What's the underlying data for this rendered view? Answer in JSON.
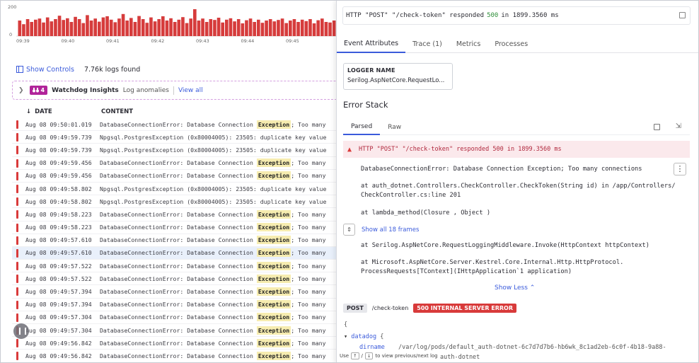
{
  "histogram": {
    "y_ticks": [
      "200",
      "0"
    ],
    "x_ticks": [
      "09:39",
      "09:40",
      "09:41",
      "09:42",
      "09:43",
      "09:44",
      "09:45"
    ],
    "bar_color": "#d63c3c",
    "bar_levels": [
      0.55,
      0.42,
      0.6,
      0.5,
      0.58,
      0.62,
      0.48,
      0.66,
      0.52,
      0.6,
      0.72,
      0.57,
      0.63,
      0.5,
      0.68,
      0.6,
      0.46,
      0.74,
      0.55,
      0.62,
      0.51,
      0.66,
      0.7,
      0.58,
      0.49,
      0.62,
      0.78,
      0.55,
      0.64,
      0.5,
      0.71,
      0.6,
      0.47,
      0.66,
      0.52,
      0.6,
      0.7,
      0.55,
      0.63,
      0.5,
      0.58,
      0.67,
      0.46,
      0.62,
      0.95,
      0.55,
      0.62,
      0.5,
      0.6,
      0.57,
      0.65,
      0.48,
      0.58,
      0.63,
      0.52,
      0.6,
      0.45,
      0.56,
      0.62,
      0.5,
      0.58,
      0.47,
      0.55,
      0.6,
      0.52,
      0.57,
      0.62,
      0.46,
      0.55,
      0.6,
      0.5,
      0.58,
      0.53,
      0.6,
      0.45,
      0.56,
      0.62,
      0.5,
      0.48,
      0.55
    ]
  },
  "toolbar": {
    "show_controls": "Show Controls",
    "logs_found": "7.76k logs found"
  },
  "watchdog": {
    "count": "4",
    "title": "Watchdog Insights",
    "subtitle": "Log anomalies",
    "view_all": "View all"
  },
  "columns": {
    "date": "DATE",
    "content": "CONTENT"
  },
  "rows": [
    {
      "date": "Aug 08 09:50:01.019",
      "pre": "DatabaseConnectionError: Database Connection ",
      "hl": "Exception",
      "post": "; Too many"
    },
    {
      "date": "Aug 08 09:49:59.739",
      "pre": "Npgsql.PostgresException (0x80004005): 23505: duplicate key value",
      "hl": "",
      "post": ""
    },
    {
      "date": "Aug 08 09:49:59.739",
      "pre": "Npgsql.PostgresException (0x80004005): 23505: duplicate key value",
      "hl": "",
      "post": ""
    },
    {
      "date": "Aug 08 09:49:59.456",
      "pre": "DatabaseConnectionError: Database Connection ",
      "hl": "Exception",
      "post": "; Too many"
    },
    {
      "date": "Aug 08 09:49:59.456",
      "pre": "DatabaseConnectionError: Database Connection ",
      "hl": "Exception",
      "post": "; Too many"
    },
    {
      "date": "Aug 08 09:49:58.802",
      "pre": "Npgsql.PostgresException (0x80004005): 23505: duplicate key value",
      "hl": "",
      "post": ""
    },
    {
      "date": "Aug 08 09:49:58.802",
      "pre": "Npgsql.PostgresException (0x80004005): 23505: duplicate key value",
      "hl": "",
      "post": ""
    },
    {
      "date": "Aug 08 09:49:58.223",
      "pre": "DatabaseConnectionError: Database Connection ",
      "hl": "Exception",
      "post": "; Too many"
    },
    {
      "date": "Aug 08 09:49:58.223",
      "pre": "DatabaseConnectionError: Database Connection ",
      "hl": "Exception",
      "post": "; Too many"
    },
    {
      "date": "Aug 08 09:49:57.610",
      "pre": "DatabaseConnectionError: Database Connection ",
      "hl": "Exception",
      "post": "; Too many"
    },
    {
      "date": "Aug 08 09:49:57.610",
      "pre": "DatabaseConnectionError: Database Connection ",
      "hl": "Exception",
      "post": "; Too many",
      "selected": true
    },
    {
      "date": "Aug 08 09:49:57.522",
      "pre": "DatabaseConnectionError: Database Connection ",
      "hl": "Exception",
      "post": "; Too many"
    },
    {
      "date": "Aug 08 09:49:57.522",
      "pre": "DatabaseConnectionError: Database Connection ",
      "hl": "Exception",
      "post": "; Too many"
    },
    {
      "date": "Aug 08 09:49:57.394",
      "pre": "DatabaseConnectionError: Database Connection ",
      "hl": "Exception",
      "post": "; Too many"
    },
    {
      "date": "Aug 08 09:49:57.394",
      "pre": "DatabaseConnectionError: Database Connection ",
      "hl": "Exception",
      "post": "; Too many"
    },
    {
      "date": "Aug 08 09:49:57.304",
      "pre": "DatabaseConnectionError: Database Connection ",
      "hl": "Exception",
      "post": "; Too many"
    },
    {
      "date": "Aug 08 09:49:57.304",
      "pre": "DatabaseConnectionError: Database Connection ",
      "hl": "Exception",
      "post": "; Too many"
    },
    {
      "date": "Aug 08 09:49:56.842",
      "pre": "DatabaseConnectionError: Database Connection ",
      "hl": "Exception",
      "post": "; Too many"
    },
    {
      "date": "Aug 08 09:49:56.842",
      "pre": "DatabaseConnectionError: Database Connection ",
      "hl": "Exception",
      "post": "; Too many"
    }
  ],
  "detail": {
    "title_pre": "HTTP \"POST\" \"/check-token\" responded ",
    "title_code": "500",
    "title_post": " in 1899.3560 ms",
    "tabs": [
      "Event Attributes",
      "Trace (1)",
      "Metrics",
      "Processes"
    ],
    "logger_key": "LOGGER NAME",
    "logger_value": "Serilog.AspNetCore.RequestLo...",
    "error_stack_title": "Error Stack",
    "stack_tabs": [
      "Parsed",
      "Raw"
    ],
    "error_message": "HTTP \"POST\" \"/check-token\" responded 500 in 1899.3560 ms",
    "stack_lines": [
      "DatabaseConnectionError: Database Connection Exception; Too many connections",
      "at auth_dotnet.Controllers.CheckController.CheckToken(String id) in /app/Controllers/",
      "CheckController.cs:line 201",
      "at lambda_method(Closure , Object )",
      "at Serilog.AspNetCore.RequestLoggingMiddleware.Invoke(HttpContext httpContext)",
      "at Microsoft.AspNetCore.Server.Kestrel.Core.Internal.Http.HttpProtocol.",
      "ProcessRequests[TContext](IHttpApplication`1 application)"
    ],
    "show_all": "Show all 18 frames",
    "show_less": "Show Less",
    "method": "POST",
    "path": "/check-token",
    "status": "500 INTERNAL SERVER ERROR",
    "json_open": "{",
    "json_key": "datadog",
    "json_brace": "{",
    "json_dirname_key": "dirname",
    "json_dirname_val": "/var/log/pods/default_auth-dotnet-6c7d7d7b6-hb6wk_8c1ad2eb-6c0f-4b18-9a88-",
    "json_tail": "auth-dotnet",
    "nav_use": "Use",
    "nav_up": "↑",
    "nav_down": "↓",
    "nav_text": "to view previous/next log"
  }
}
